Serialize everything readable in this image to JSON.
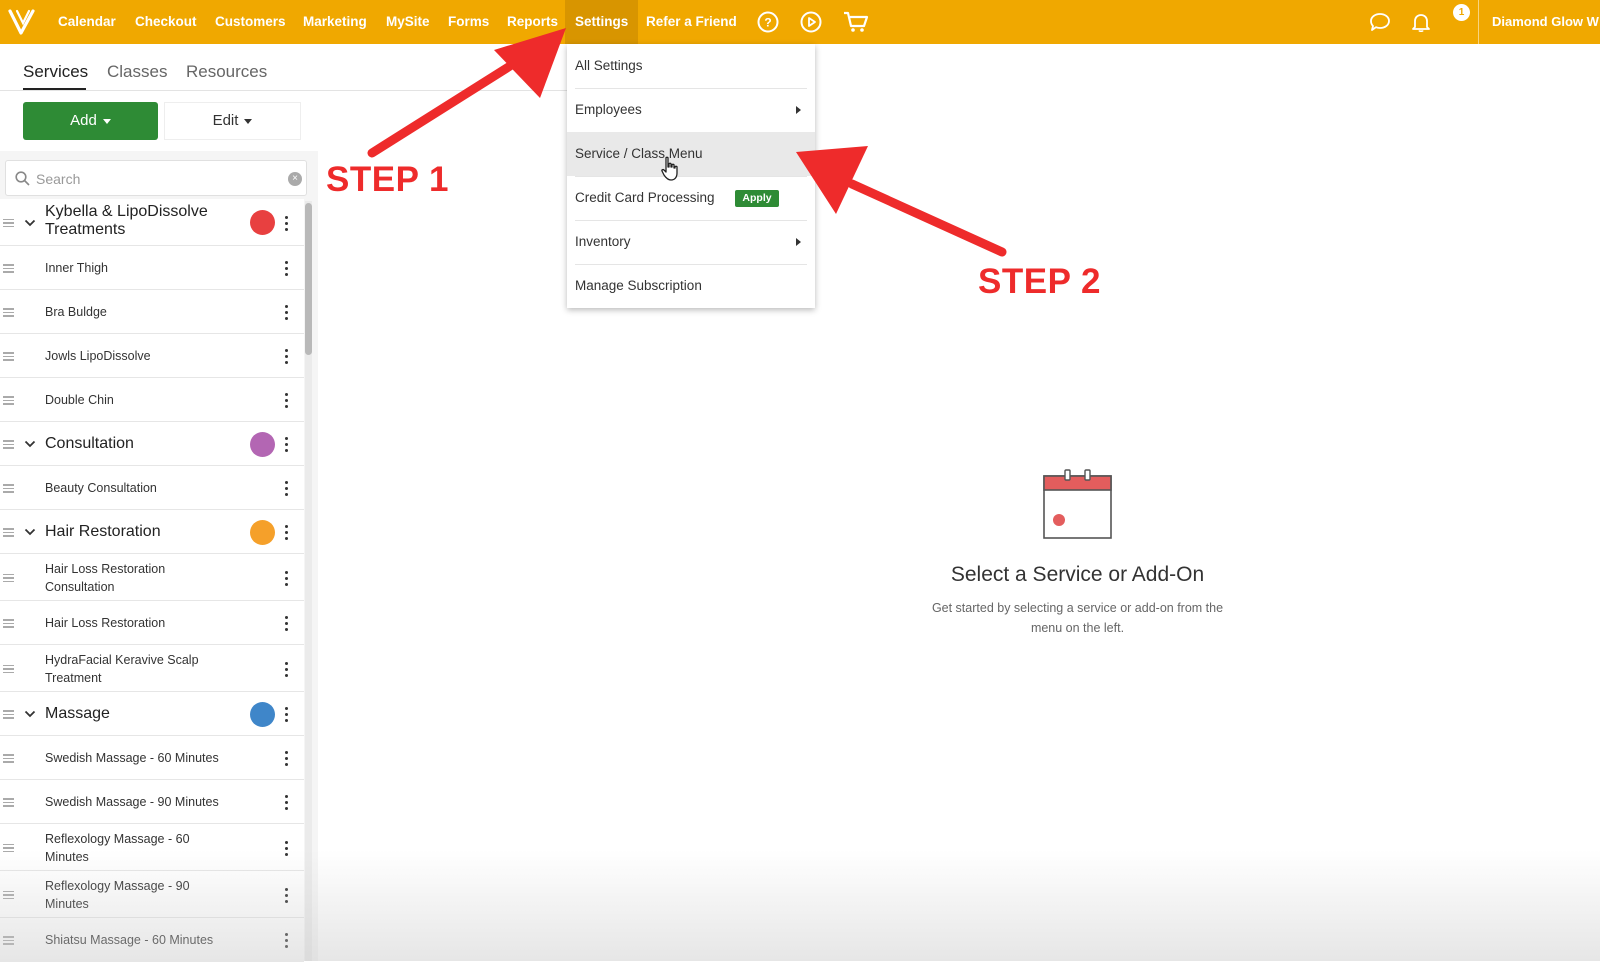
{
  "topbar": {
    "nav": [
      "Calendar",
      "Checkout",
      "Customers",
      "Marketing",
      "MySite",
      "Forms",
      "Reports",
      "Settings",
      "Refer a Friend"
    ],
    "notification_count": "1",
    "account_name": "Diamond Glow W"
  },
  "tabs": [
    "Services",
    "Classes",
    "Resources"
  ],
  "toolbar": {
    "add_label": "Add",
    "edit_label": "Edit"
  },
  "search": {
    "placeholder": "Search"
  },
  "service_list": [
    {
      "type": "group",
      "label": "Kybella & LipoDissolve Treatments",
      "color": "#e84040"
    },
    {
      "type": "item",
      "label": "Inner Thigh"
    },
    {
      "type": "item",
      "label": "Bra Buldge"
    },
    {
      "type": "item",
      "label": "Jowls LipoDissolve"
    },
    {
      "type": "item",
      "label": "Double Chin"
    },
    {
      "type": "group",
      "label": "Consultation",
      "color": "#b366b3"
    },
    {
      "type": "item",
      "label": "Beauty Consultation"
    },
    {
      "type": "group",
      "label": "Hair Restoration",
      "color": "#f5a02a"
    },
    {
      "type": "item",
      "label": "Hair Loss Restoration Consultation"
    },
    {
      "type": "item",
      "label": "Hair Loss Restoration"
    },
    {
      "type": "item",
      "label": "HydraFacial Keravive Scalp Treatment"
    },
    {
      "type": "group",
      "label": "Massage",
      "color": "#3f86c9"
    },
    {
      "type": "item",
      "label": "Swedish Massage - 60 Minutes"
    },
    {
      "type": "item",
      "label": "Swedish Massage - 90 Minutes"
    },
    {
      "type": "item",
      "label": "Reflexology Massage - 60 Minutes"
    },
    {
      "type": "item",
      "label": "Reflexology Massage - 90 Minutes"
    },
    {
      "type": "item",
      "label": "Shiatsu Massage - 60 Minutes"
    }
  ],
  "settings_menu": {
    "items": [
      "All Settings",
      "Employees",
      "Service / Class Menu",
      "Credit Card Processing",
      "Inventory",
      "Manage Subscription"
    ],
    "apply_badge": "Apply"
  },
  "annotations": {
    "step1": "STEP 1",
    "step2": "STEP 2"
  },
  "empty_state": {
    "title": "Select a Service or Add-On",
    "description": "Get started by selecting a service or add-on from the menu on the left."
  },
  "colors": {
    "topbar": "#f0a800",
    "add_button": "#2e8b35",
    "annotation": "#ee2b2b"
  }
}
